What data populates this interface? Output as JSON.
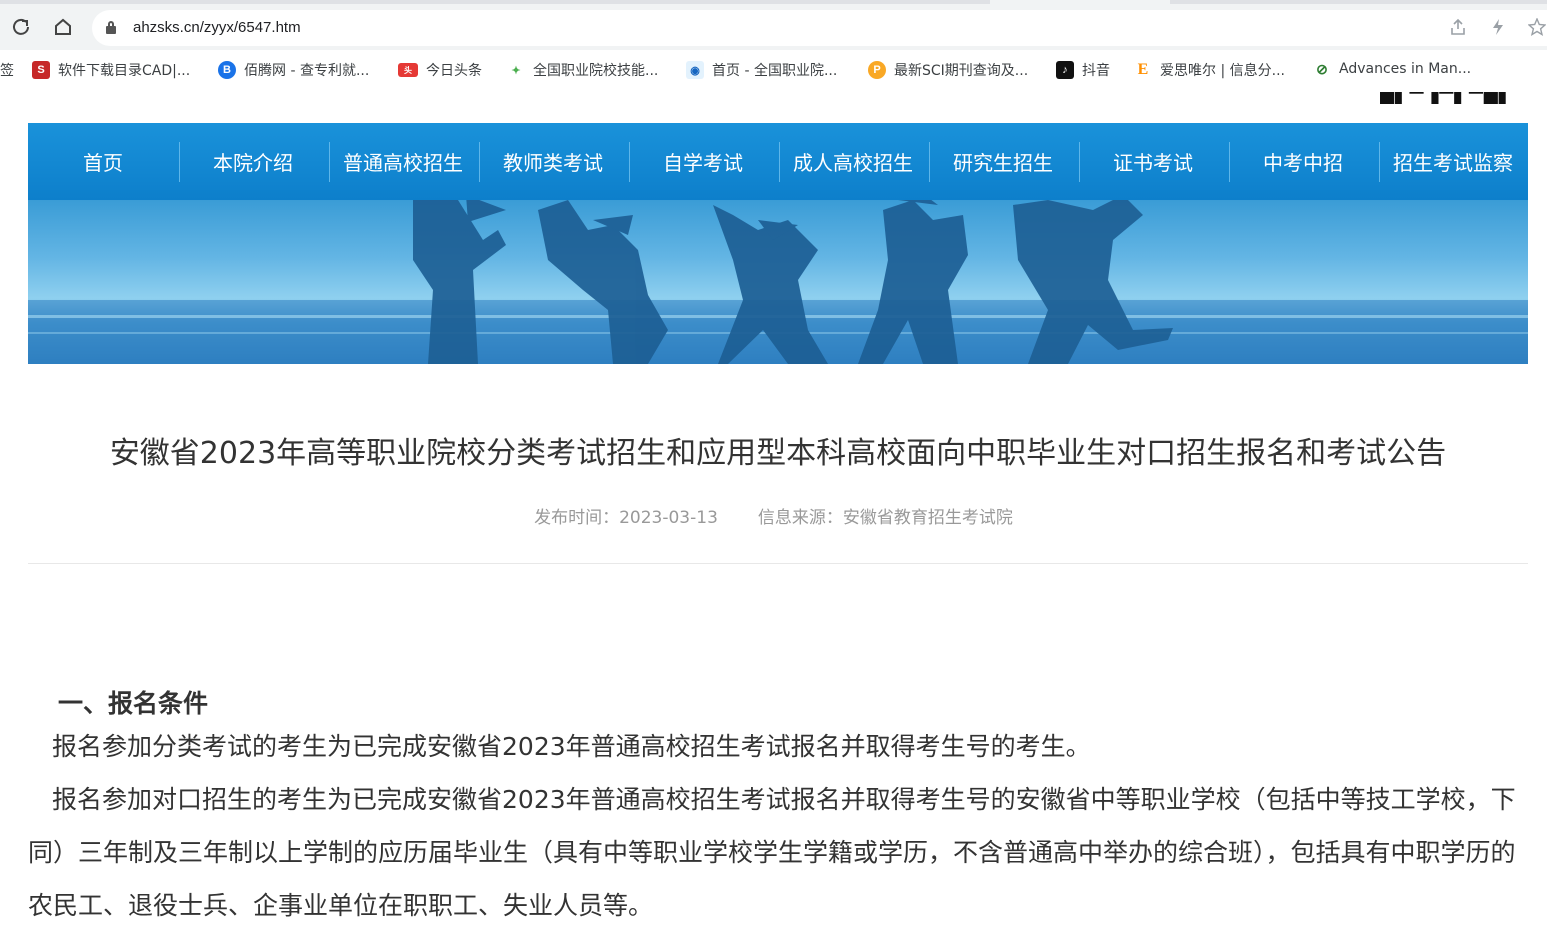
{
  "browser": {
    "url": "ahzsks.cn/zyyx/6547.htm",
    "bookmarks": [
      {
        "label": "签",
        "icon": "partial-bookmark"
      },
      {
        "label": "软件下载目录CAD|...",
        "icon": "software-icon",
        "color": "#c62828"
      },
      {
        "label": "佰腾网 - 查专利就...",
        "icon": "baiten-icon",
        "color": "#1a73e8"
      },
      {
        "label": "今日头条",
        "icon": "toutiao-icon",
        "color": "#e53935"
      },
      {
        "label": "全国职业院校技能...",
        "icon": "skills-icon",
        "color": "#4caf50"
      },
      {
        "label": "首页 - 全国职业院...",
        "icon": "vocational-icon",
        "color": "#1565c0"
      },
      {
        "label": "最新SCI期刊查询及...",
        "icon": "sci-icon",
        "color": "#f9a825"
      },
      {
        "label": "抖音",
        "icon": "douyin-icon",
        "color": "#111111"
      },
      {
        "label": "爱思唯尔 | 信息分...",
        "icon": "elsevier-icon",
        "color": "#ff8f00"
      },
      {
        "label": "Advances in Man...",
        "icon": "advances-icon",
        "color": "#2e7d32"
      }
    ]
  },
  "site": {
    "nav": [
      "首页",
      "本院介绍",
      "普通高校招生",
      "教师类考试",
      "自学考试",
      "成人高校招生",
      "研究生招生",
      "证书考试",
      "中考中招",
      "招生考试监察"
    ],
    "nav_color": "#1a8ad6"
  },
  "article": {
    "title": "安徽省2023年高等职业院校分类考试招生和应用型本科高校面向中职毕业生对口招生报名和考试公告",
    "publish_time": "发布时间：2023-03-13",
    "source": "信息来源：安徽省教育招生考试院",
    "section1_heading": "一、报名条件",
    "para1": "报名参加分类考试的考生为已完成安徽省2023年普通高校招生考试报名并取得考生号的考生。",
    "para2": "报名参加对口招生的考生为已完成安徽省2023年普通高校招生考试报名并取得考生号的安徽省中等职业学校（包括中等技工学校，下同）三年制及三年制以上学制的应历届毕业生（具有中等职业学校学生学籍或学历，不含普通高中举办的综合班），包括具有中职学历的农民工、退役士兵、企事业单位在职职工、失业人员等。"
  }
}
